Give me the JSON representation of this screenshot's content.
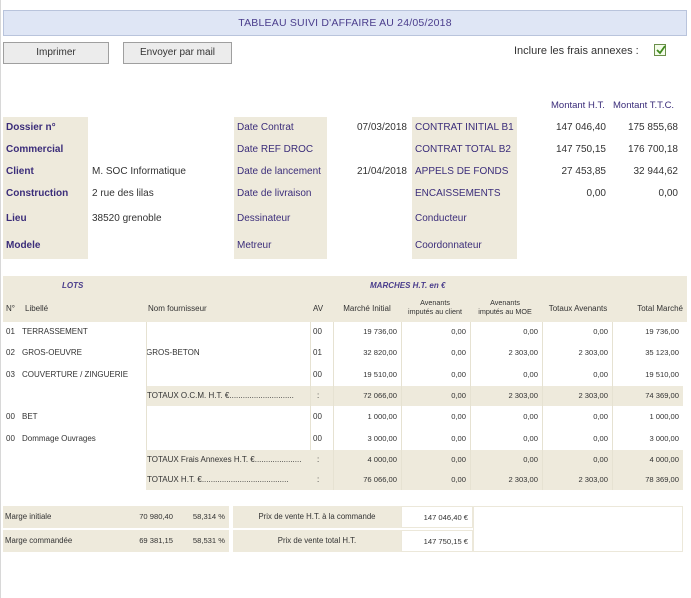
{
  "title": "TABLEAU SUIVI D'AFFAIRE AU 24/05/2018",
  "toolbar": {
    "print_label": "Imprimer",
    "mail_label": "Envoyer par mail",
    "include_fees_label": "Inclure les frais annexes :",
    "include_fees_checked": true
  },
  "amount_headers": {
    "ht": "Montant H.T.",
    "ttc": "Montant T.T.C."
  },
  "info": {
    "dossier_label": "Dossier n°",
    "dossier_value": "",
    "commercial_label": "Commercial",
    "commercial_value": "",
    "client_label": "Client",
    "client_value": "M. SOC Informatique",
    "construction_label": "Construction",
    "construction_value": "2 rue des lilas",
    "lieu_label": "Lieu",
    "lieu_value": "38520 grenoble",
    "modele_label": "Modele",
    "modele_value": "",
    "date_contrat_label": "Date Contrat",
    "date_contrat_value": "07/03/2018",
    "date_ref_droc_label": "Date REF  DROC",
    "date_ref_droc_value": "",
    "date_lancement_label": "Date de lancement",
    "date_lancement_value": "21/04/2018",
    "date_livraison_label": "Date de livraison",
    "date_livraison_value": "",
    "dessinateur_label": "Dessinateur",
    "dessinateur_value": "",
    "metreur_label": "Metreur",
    "metreur_value": "",
    "contrat_initial_label": "CONTRAT INITIAL B1",
    "contrat_initial_ht": "147 046,40",
    "contrat_initial_ttc": "175 855,68",
    "contrat_total_label": "CONTRAT TOTAL B2",
    "contrat_total_ht": "147 750,15",
    "contrat_total_ttc": "176 700,18",
    "appels_label": "APPELS DE FONDS",
    "appels_ht": "27 453,85",
    "appels_ttc": "32 944,62",
    "encaissements_label": "ENCAISSEMENTS",
    "encaissements_ht": "0,00",
    "encaissements_ttc": "0,00",
    "conducteur_label": "Conducteur",
    "conducteur_value": "",
    "coordonnateur_label": "Coordonnateur",
    "coordonnateur_value": ""
  },
  "lots": {
    "section_lots": "LOTS",
    "section_marches": "MARCHES H.T. en €",
    "headers": {
      "n": "N°",
      "libelle": "Libellé",
      "fournisseur": "Nom fournisseur",
      "av": "AV",
      "marche_initial": "Marché Initial",
      "avenants_client_1": "Avenants",
      "avenants_client_2": "imputés au client",
      "avenants_moe_1": "Avenants",
      "avenants_moe_2": "imputés au MOE",
      "totaux_avenants": "Totaux Avenants",
      "total_marche": "Total Marché"
    },
    "rows": [
      {
        "n": "01",
        "libelle": "TERRASSEMENT",
        "fournisseur": "",
        "av": "00",
        "marche_initial": "19 736,00",
        "av_client": "0,00",
        "av_moe": "0,00",
        "tot_av": "0,00",
        "total": "19 736,00"
      },
      {
        "n": "02",
        "libelle": "GROS-OEUVRE",
        "fournisseur": "GROS-BETON",
        "av": "01",
        "marche_initial": "32 820,00",
        "av_client": "0,00",
        "av_moe": "2 303,00",
        "tot_av": "2 303,00",
        "total": "35 123,00"
      },
      {
        "n": "03",
        "libelle": "COUVERTURE / ZINGUERIE",
        "fournisseur": "",
        "av": "00",
        "marche_initial": "19 510,00",
        "av_client": "0,00",
        "av_moe": "0,00",
        "tot_av": "0,00",
        "total": "19 510,00"
      }
    ],
    "totaux_ocm": {
      "label": "TOTAUX O.C.M.  H.T. €.............................",
      "sep": ":",
      "marche_initial": "72 066,00",
      "av_client": "0,00",
      "av_moe": "2 303,00",
      "tot_av": "2 303,00",
      "total": "74 369,00"
    },
    "annex_rows": [
      {
        "n": "00",
        "libelle": "BET",
        "fournisseur": "",
        "av": "00",
        "marche_initial": "1 000,00",
        "av_client": "0,00",
        "av_moe": "0,00",
        "tot_av": "0,00",
        "total": "1 000,00"
      },
      {
        "n": "00",
        "libelle": "Dommage Ouvrages",
        "fournisseur": "",
        "av": "00",
        "marche_initial": "3 000,00",
        "av_client": "0,00",
        "av_moe": "0,00",
        "tot_av": "0,00",
        "total": "3 000,00"
      }
    ],
    "totaux_annexes": {
      "label": "TOTAUX Frais Annexes H.T. €.....................",
      "sep": ":",
      "marche_initial": "4 000,00",
      "av_client": "0,00",
      "av_moe": "0,00",
      "tot_av": "0,00",
      "total": "4 000,00"
    },
    "totaux_ht": {
      "label": "TOTAUX H.T. €.......................................",
      "sep": ":",
      "marche_initial": "76 066,00",
      "av_client": "0,00",
      "av_moe": "2 303,00",
      "tot_av": "2 303,00",
      "total": "78 369,00"
    }
  },
  "margins": {
    "initiale_label": "Marge initiale",
    "initiale_value": "70 980,40",
    "initiale_pct": "58,314 %",
    "commandee_label": "Marge commandée",
    "commandee_value": "69 381,15",
    "commandee_pct": "58,531 %",
    "prix_commande_label": "Prix de vente H.T. à la commande",
    "prix_commande_value": "147 046,40 €",
    "prix_total_label": "Prix de vente total H.T.",
    "prix_total_value": "147 750,15 €"
  }
}
